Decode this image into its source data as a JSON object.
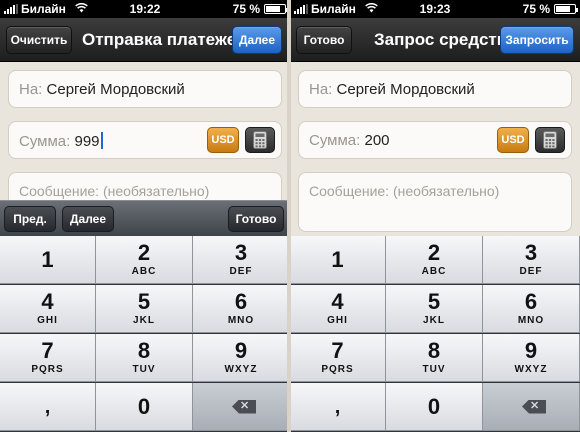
{
  "left": {
    "status": {
      "carrier": "Билайн",
      "time": "19:22",
      "battery": "75 %",
      "battery_level": 0.75
    },
    "navbar": {
      "left_button": "Очистить",
      "title": "Отправка платежей",
      "right_button": "Далее"
    },
    "to_field": {
      "label": "На:",
      "value": "Сергей Мордовский"
    },
    "amount_field": {
      "label": "Сумма:",
      "value": "999",
      "currency": "USD"
    },
    "message_field": {
      "placeholder": "Сообщение: (необязательно)"
    },
    "accessory": {
      "prev": "Пред.",
      "next": "Далее",
      "done": "Готово"
    }
  },
  "right": {
    "status": {
      "carrier": "Билайн",
      "time": "19:23",
      "battery": "75 %",
      "battery_level": 0.75
    },
    "navbar": {
      "left_button": "Готово",
      "title": "Запрос средств",
      "right_button": "Запросить"
    },
    "to_field": {
      "label": "На:",
      "value": "Сергей Мордовский"
    },
    "amount_field": {
      "label": "Сумма:",
      "value": "200",
      "currency": "USD"
    },
    "message_field": {
      "placeholder": "Сообщение: (необязательно)"
    }
  },
  "keypad": {
    "keys": [
      {
        "num": "1",
        "letters": ""
      },
      {
        "num": "2",
        "letters": "ABC"
      },
      {
        "num": "3",
        "letters": "DEF"
      },
      {
        "num": "4",
        "letters": "GHI"
      },
      {
        "num": "5",
        "letters": "JKL"
      },
      {
        "num": "6",
        "letters": "MNO"
      },
      {
        "num": "7",
        "letters": "PQRS"
      },
      {
        "num": "8",
        "letters": "TUV"
      },
      {
        "num": "9",
        "letters": "WXYZ"
      },
      {
        "num": ",",
        "letters": ""
      },
      {
        "num": "0",
        "letters": ""
      }
    ]
  },
  "icons": {
    "signal": "signal-icon",
    "wifi": "wifi-icon",
    "battery": "battery-icon",
    "calculator": "calculator-icon",
    "backspace": "backspace-icon"
  }
}
